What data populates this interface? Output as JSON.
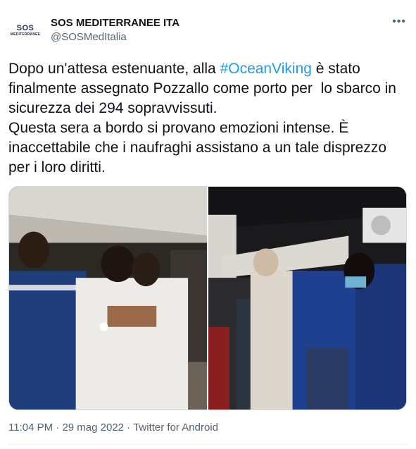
{
  "author": {
    "display_name": "SOS MEDITERRANEE ITA",
    "handle": "@SOSMedItalia",
    "avatar_text_top": "SOS",
    "avatar_text_bottom": "MEDITERRANEE"
  },
  "more_icon": "more-dots-icon",
  "tweet": {
    "text_before": "Dopo un'attesa estenuante, alla ",
    "hashtag": "#OceanViking",
    "text_after": " è stato finalmente assegnato Pozzallo come porto per  lo sbarco in sicurezza dei 294 sopravvissuti.\nQuesta sera a bordo si provano emozioni intense. È inaccettabile che i naufraghi assistano a un tale disprezzo per i loro diritti."
  },
  "meta": {
    "time": "11:04 PM",
    "separator": " · ",
    "date": "29 mag 2022",
    "source": "Twitter for Android"
  },
  "colors": {
    "link": "#1d9bf0",
    "text": "#0f1419",
    "secondary": "#536471"
  }
}
